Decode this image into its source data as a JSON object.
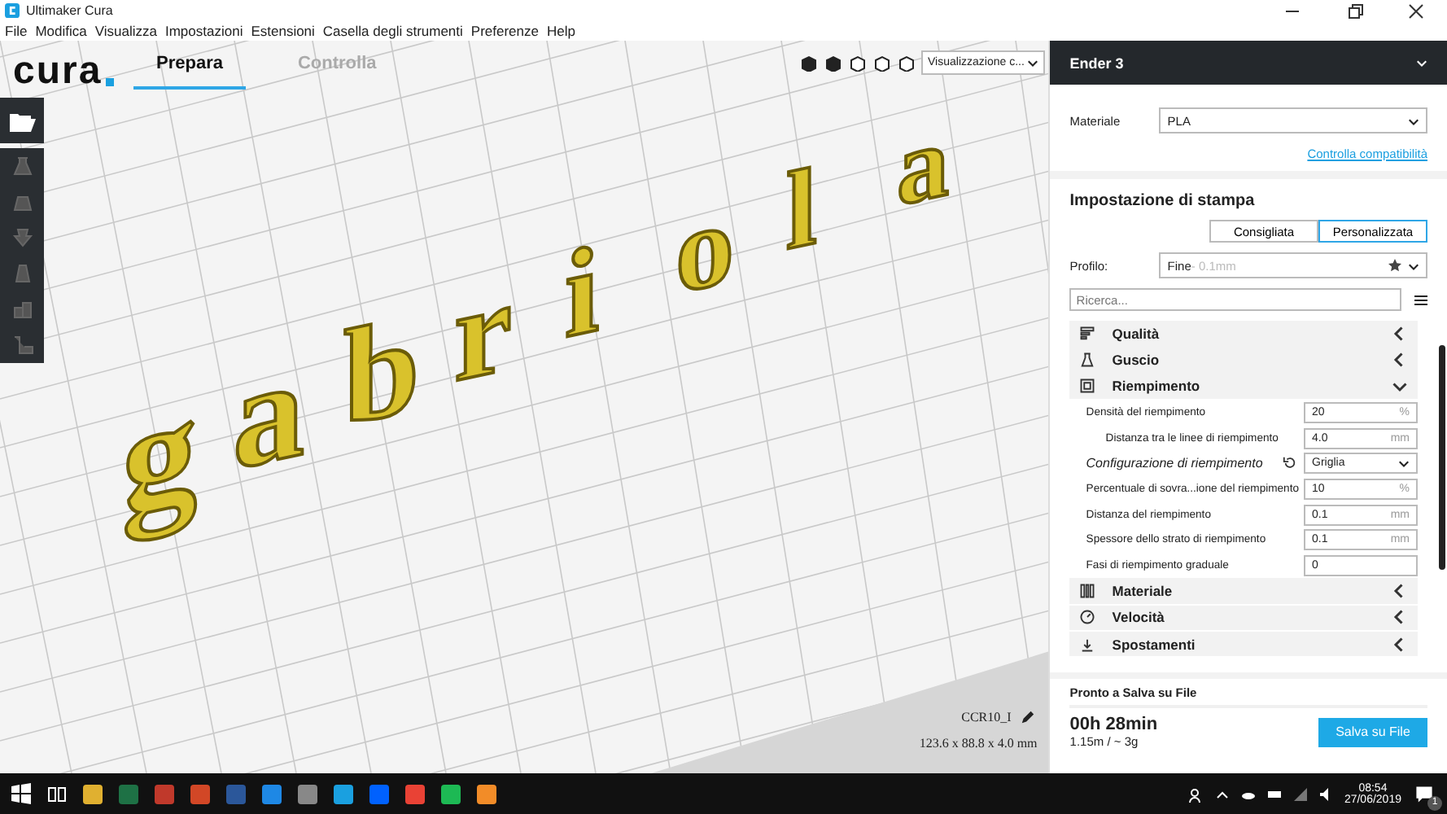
{
  "window": {
    "title": "Ultimaker Cura"
  },
  "menu": [
    "File",
    "Modifica",
    "Visualizza",
    "Impostazioni",
    "Estensioni",
    "Casella degli strumenti",
    "Preferenze",
    "Help"
  ],
  "header": {
    "logo": "cura",
    "tabs": [
      {
        "label": "Prepara",
        "selected": true
      },
      {
        "label": "Controlla",
        "selected": false
      }
    ]
  },
  "view": {
    "dropdown": "Visualizzazione c..."
  },
  "model": {
    "letters": [
      "g",
      "a",
      "b",
      "r",
      "i",
      "o",
      "l",
      "a"
    ],
    "name": "CCR10_I",
    "dimensions": "123.6 x 88.8 x 4.0 mm"
  },
  "printer": {
    "name": "Ender 3"
  },
  "material": {
    "label": "Materiale",
    "value": "PLA",
    "link": "Controlla compatibilità"
  },
  "print_settings": {
    "title": "Impostazione di stampa",
    "modes": [
      {
        "label": "Consigliata",
        "selected": false
      },
      {
        "label": "Personalizzata",
        "selected": true
      }
    ],
    "profile_label": "Profilo:",
    "profile": "Fine",
    "profile_detail": " - 0.1mm",
    "search_placeholder": "Ricerca...",
    "items": [
      {
        "kind": "category",
        "label": "Qualità",
        "expanded": false
      },
      {
        "kind": "category",
        "label": "Guscio",
        "expanded": false
      },
      {
        "kind": "category",
        "label": "Riempimento",
        "expanded": true
      },
      {
        "kind": "field",
        "label": "Densità del riempimento",
        "value": "20",
        "unit": "%",
        "indented": false,
        "modified": false
      },
      {
        "kind": "field",
        "label": "Distanza tra le linee di riempimento",
        "value": "4.0",
        "unit": "mm",
        "indented": true,
        "modified": false
      },
      {
        "kind": "dropdown",
        "label": "Configurazione di riempimento",
        "value": "Griglia",
        "indented": false,
        "modified": true
      },
      {
        "kind": "field",
        "label": "Percentuale di sovra...ione del riempimento",
        "value": "10",
        "unit": "%",
        "indented": false,
        "modified": false
      },
      {
        "kind": "field",
        "label": "Distanza del riempimento",
        "value": "0.1",
        "unit": "mm",
        "indented": false,
        "modified": false
      },
      {
        "kind": "field",
        "label": "Spessore dello strato di riempimento",
        "value": "0.1",
        "unit": "mm",
        "indented": false,
        "modified": false
      },
      {
        "kind": "field",
        "label": "Fasi di riempimento graduale",
        "value": "0",
        "indented": false,
        "modified": false
      },
      {
        "kind": "category",
        "label": "Materiale",
        "expanded": false
      },
      {
        "kind": "category",
        "label": "Velocità",
        "expanded": false
      },
      {
        "kind": "category",
        "label": "Spostamenti",
        "expanded": false
      }
    ]
  },
  "footer": {
    "status": "Pronto a Salva su File",
    "time": "00h 28min",
    "usage": "1.15m / ~ 3g",
    "button": "Salva su File"
  },
  "taskbar": {
    "time": "08:54",
    "date": "27/06/2019",
    "notifications": "1"
  }
}
